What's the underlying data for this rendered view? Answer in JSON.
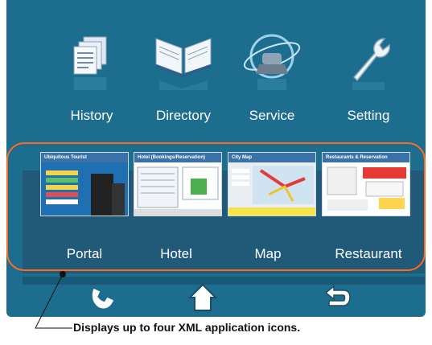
{
  "main_menu": {
    "items": [
      {
        "label": "History",
        "icon": "history-icon"
      },
      {
        "label": "Directory",
        "icon": "directory-book-icon"
      },
      {
        "label": "Service",
        "icon": "service-globe-phone-icon"
      },
      {
        "label": "Setting",
        "icon": "wrench-icon"
      }
    ]
  },
  "xml_apps": {
    "items": [
      {
        "label": "Portal",
        "thumb_title": "Ubiquitous Tourist"
      },
      {
        "label": "Hotel",
        "thumb_title": "Hotel (Bookings/Reservation)"
      },
      {
        "label": "Map",
        "thumb_title": "City Map"
      },
      {
        "label": "Restaurant",
        "thumb_title": "Restaurants & Reservation"
      }
    ]
  },
  "nav": {
    "buttons": [
      {
        "icon": "phone-handset-icon"
      },
      {
        "icon": "home-icon"
      },
      {
        "icon": "back-icon"
      }
    ]
  },
  "annotation": {
    "text": "Displays up to four XML application icons."
  },
  "colors": {
    "screen_bg": "#1d6e8e",
    "tray_bg": "#205a78",
    "highlight_outline": "#ff6b21",
    "label_text": "#ffffff"
  }
}
